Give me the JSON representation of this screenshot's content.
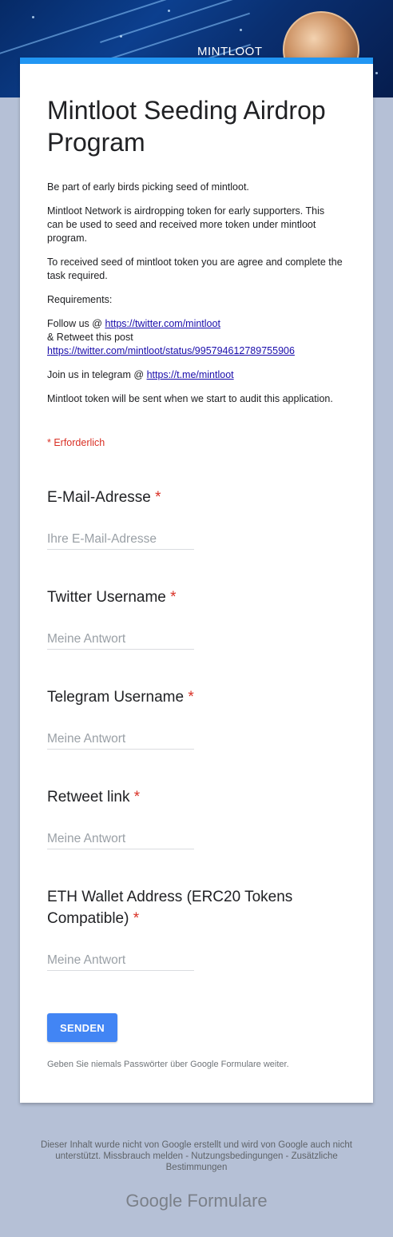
{
  "header": {
    "brand": "MINTLOOT"
  },
  "form": {
    "title": "Mintloot Seeding Airdrop Program",
    "description": {
      "p1": "Be part of early birds picking seed of mintloot.",
      "p2": "Mintloot Network is airdropping token for early supporters. This can be used to seed and received more token under mintloot program.",
      "p3": "To received seed of mintloot token you are agree and complete the task required.",
      "p4": "Requirements:",
      "follow_prefix": "Follow us @ ",
      "twitter_link": "https://twitter.com/mintloot",
      "retweet_text": "& Retweet this post",
      "status_link": "https://twitter.com/mintloot/status/995794612789755906",
      "telegram_prefix": "Join us in telegram @ ",
      "telegram_link": "https://t.me/mintloot",
      "p7": "Mintloot token will be sent when we start to audit this application."
    },
    "required_note": "* Erforderlich",
    "questions": [
      {
        "label": "E-Mail-Adresse",
        "star": "*",
        "placeholder": "Ihre E-Mail-Adresse"
      },
      {
        "label": "Twitter Username",
        "star": "*",
        "placeholder": "Meine Antwort"
      },
      {
        "label": "Telegram Username",
        "star": "*",
        "placeholder": "Meine Antwort"
      },
      {
        "label": "Retweet link",
        "star": "*",
        "placeholder": "Meine Antwort"
      },
      {
        "label": "ETH Wallet Address (ERC20 Tokens Compatible)",
        "star": "*",
        "placeholder": "Meine Antwort"
      }
    ],
    "submit_label": "SENDEN",
    "password_warning": "Geben Sie niemals Passwörter über Google Formulare weiter."
  },
  "footer": {
    "disclaimer": "Dieser Inhalt wurde nicht von Google erstellt und wird von Google auch nicht unterstützt. Missbrauch melden - Nutzungsbedingungen - Zusätzliche Bestimmungen",
    "logo_google": "Google",
    "logo_product": "Formulare"
  },
  "colors": {
    "accent": "#2196f3",
    "button": "#4285f4",
    "required": "#d93025",
    "page_bg": "#b5c0d6"
  }
}
